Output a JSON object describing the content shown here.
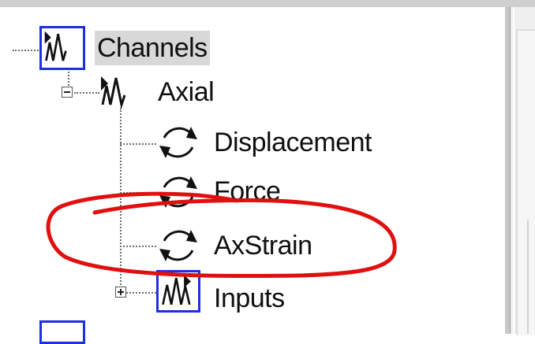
{
  "tree": {
    "nodes": [
      {
        "label": "Channels",
        "icon": "waveform-icon",
        "selected": true
      },
      {
        "label": "Axial",
        "icon": "waveform-icon",
        "expanded": true
      },
      {
        "label": "Displacement",
        "icon": "cycle-arrows-icon"
      },
      {
        "label": "Force",
        "icon": "cycle-arrows-icon"
      },
      {
        "label": "AxStrain",
        "icon": "cycle-arrows-icon"
      },
      {
        "label": "Inputs",
        "icon": "waveform-icon",
        "expanded": false
      }
    ]
  },
  "annotation": {
    "color": "#e01010",
    "circled_item": "AxStrain"
  },
  "colors": {
    "icon_border": "#1f2fe0",
    "selection_bg": "#d8d8d8"
  }
}
